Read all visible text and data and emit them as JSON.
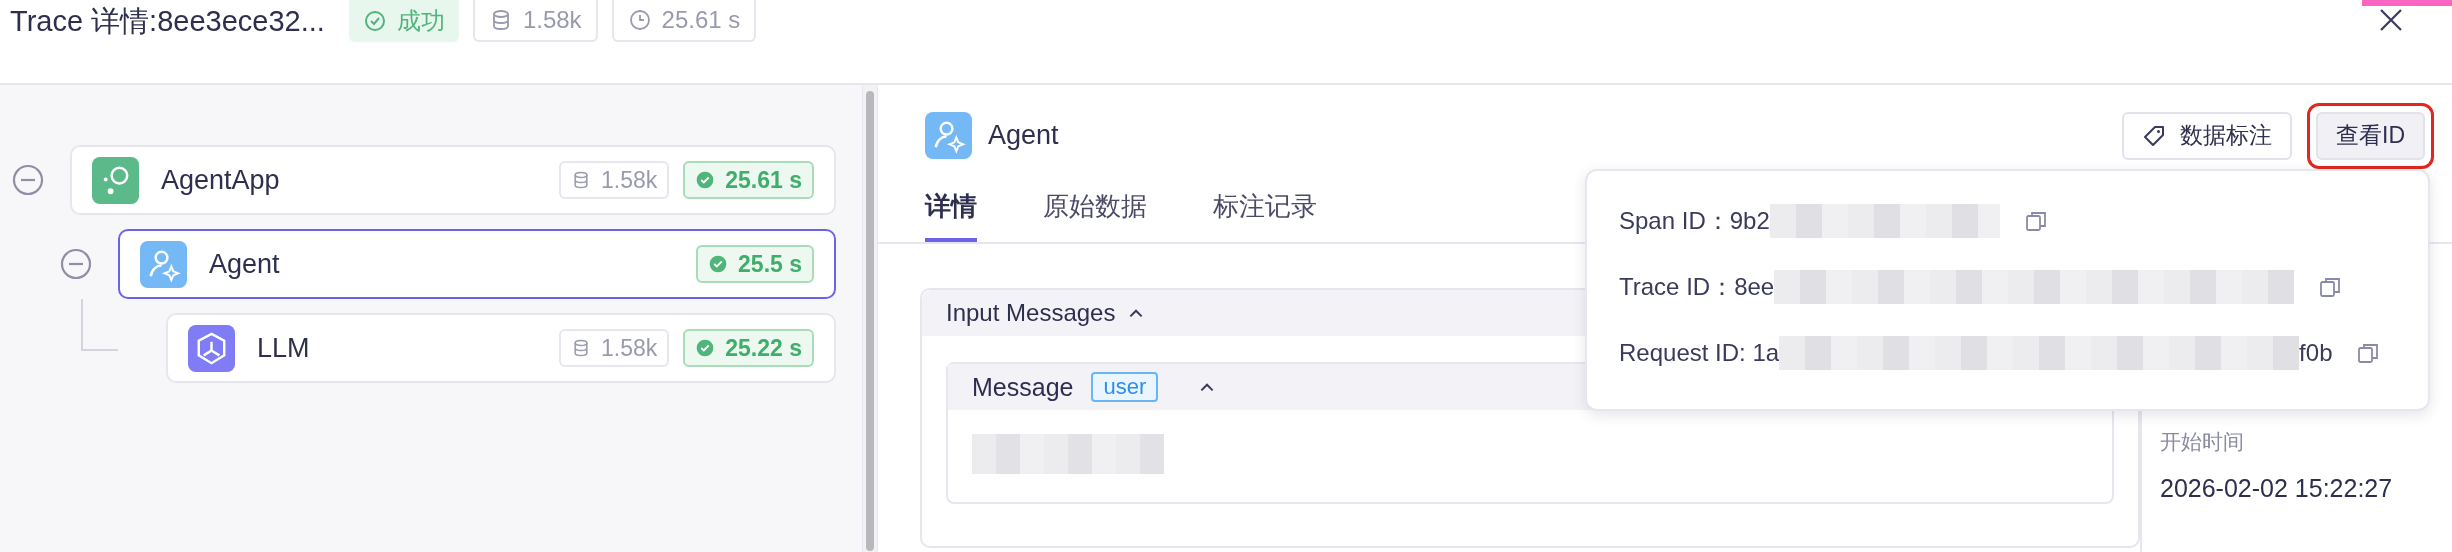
{
  "header": {
    "title": "Trace 详情:8ee3ece32...",
    "status": "成功",
    "tokens": "1.58k",
    "duration": "25.61 s"
  },
  "tree": [
    {
      "name": "AgentApp",
      "kind": "app",
      "tokens": "1.58k",
      "duration": "25.61 s",
      "selected": false,
      "expanded": true,
      "children": [
        {
          "name": "Agent",
          "kind": "agent",
          "duration": "25.5 s",
          "selected": true,
          "expanded": true,
          "children": [
            {
              "name": "LLM",
              "kind": "llm",
              "tokens": "1.58k",
              "duration": "25.22 s",
              "selected": false
            }
          ]
        }
      ]
    }
  ],
  "span": {
    "name": "Agent",
    "kind": "agent"
  },
  "actions": [
    {
      "label": "数据标注",
      "kind": "tag",
      "highlighted": false
    },
    {
      "label": "查看ID",
      "kind": "plain",
      "highlighted": true
    }
  ],
  "tabs": [
    {
      "label": "详情",
      "selected": true
    },
    {
      "label": "原始数据",
      "selected": false
    },
    {
      "label": "标注记录",
      "selected": false
    }
  ],
  "input": {
    "title": "Input Messages",
    "expanded": true,
    "message": {
      "title": "Message",
      "role": "user",
      "expanded": true
    }
  },
  "side": {
    "label": "开始时间",
    "value": "2026-02-02 15:22:27"
  },
  "ids": [
    {
      "label": "Span ID：",
      "start": "9b2"
    },
    {
      "label": "Trace ID：",
      "start": "8ee"
    },
    {
      "label": "Request ID: ",
      "start": "1a",
      "end": "f0b"
    }
  ]
}
